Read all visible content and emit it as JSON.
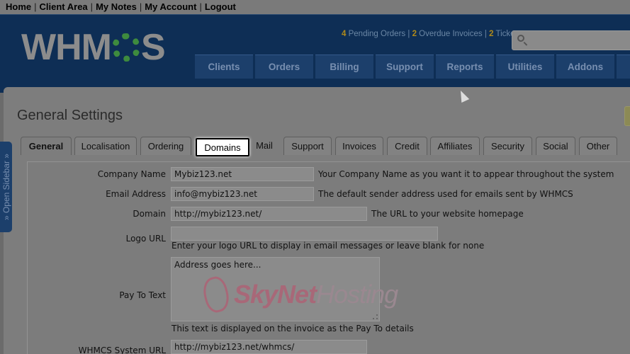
{
  "top_links": [
    "Home",
    "Client Area",
    "My Notes",
    "My Account",
    "Logout"
  ],
  "top_links_separator": "|",
  "header": {
    "logo_left": "WHM",
    "logo_right": "S",
    "stats": [
      {
        "count": "4",
        "label": "Pending Orders"
      },
      {
        "count": "2",
        "label": "Overdue Invoices"
      },
      {
        "count": "2",
        "label": "Ticket"
      }
    ],
    "stats_separator": "|",
    "search_icon": "search-icon"
  },
  "nav": [
    "Clients",
    "Orders",
    "Billing",
    "Support",
    "Reports",
    "Utilities",
    "Addons"
  ],
  "sidebar": {
    "label": "» Open Sidebar »"
  },
  "page": {
    "title": "General Settings"
  },
  "tabs": [
    "General",
    "Localisation",
    "Ordering",
    "Domains",
    "Mail",
    "Support",
    "Invoices",
    "Credit",
    "Affiliates",
    "Security",
    "Social",
    "Other"
  ],
  "active_tab": "General",
  "highlighted_tab": "Domains",
  "form": {
    "company_name": {
      "label": "Company Name",
      "value": "Mybiz123.net",
      "desc": "Your Company Name as you want it to appear throughout the system"
    },
    "email_address": {
      "label": "Email Address",
      "value": "info@mybiz123.net",
      "desc": "The default sender address used for emails sent by WHMCS"
    },
    "domain": {
      "label": "Domain",
      "value": "http://mybiz123.net/",
      "desc": "The URL to your website homepage"
    },
    "logo_url": {
      "label": "Logo URL",
      "value": "",
      "desc": "Enter your logo URL to display in email messages or leave blank for none"
    },
    "pay_to_text": {
      "label": "Pay To Text",
      "value": "Address goes here...",
      "desc": "This text is displayed on the invoice as the Pay To details"
    },
    "system_url": {
      "label": "WHMCS System URL",
      "value": "http://mybiz123.net/whmcs/"
    }
  },
  "watermark": {
    "part1": "SkyNet",
    "part2": "Hosting"
  },
  "colors": {
    "header_bg": "#0e2e55",
    "nav_tab": "#1c3f6b",
    "stat_num": "#b08a1a",
    "logo_gear": "#3e8b3e",
    "watermark": "#a86878"
  }
}
